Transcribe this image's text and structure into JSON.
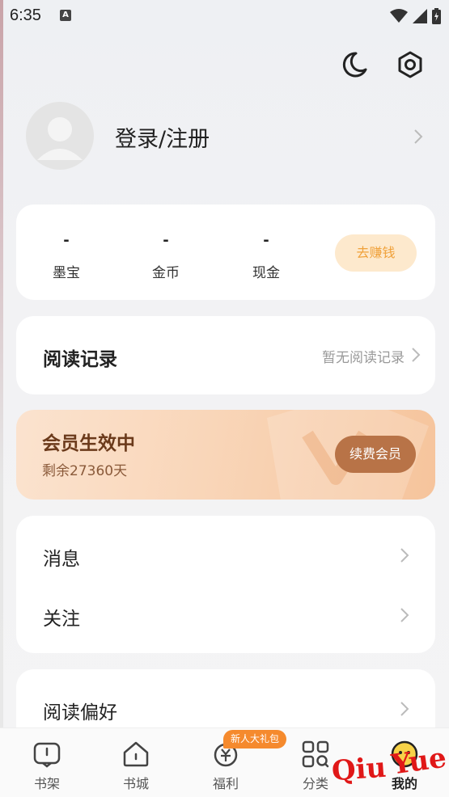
{
  "status_bar": {
    "time": "6:35",
    "notification_icon": "a-icon",
    "right_icons": [
      "wifi-icon",
      "signal-icon",
      "battery-icon"
    ]
  },
  "header": {
    "icons": [
      "moon-icon",
      "gear-icon"
    ]
  },
  "profile": {
    "login_label": "登录/注册"
  },
  "stats": {
    "items": [
      {
        "value": "-",
        "label": "墨宝"
      },
      {
        "value": "-",
        "label": "金币"
      },
      {
        "value": "-",
        "label": "现金"
      }
    ],
    "earn_button": "去赚钱"
  },
  "reading_history": {
    "title": "阅读记录",
    "status": "暂无阅读记录"
  },
  "vip": {
    "title": "会员生效中",
    "remaining": "剩余27360天",
    "renew_button": "续费会员"
  },
  "menu": {
    "items": [
      {
        "label": "消息"
      },
      {
        "label": "关注"
      }
    ]
  },
  "preferences": {
    "title": "阅读偏好"
  },
  "tabbar": {
    "badge": "新人大礼包",
    "tabs": [
      {
        "label": "书架",
        "icon": "bookshelf-icon"
      },
      {
        "label": "书城",
        "icon": "bookstore-icon"
      },
      {
        "label": "福利",
        "icon": "welfare-icon"
      },
      {
        "label": "分类",
        "icon": "category-icon"
      },
      {
        "label": "我的",
        "icon": "profile-icon"
      }
    ],
    "active_index": 4
  },
  "watermark": {
    "word1": "Qiu",
    "word2": "Yue"
  },
  "colors": {
    "earn_bg": "#fde9cd",
    "earn_text": "#f0a13a",
    "vip_button": "#b87347",
    "badge": "#f58a2d"
  }
}
